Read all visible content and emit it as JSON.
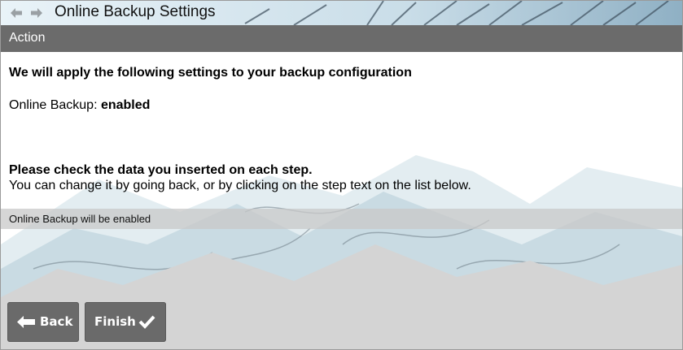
{
  "window": {
    "title": "Online Backup Settings",
    "nav_back_icon": "arrow-left-icon",
    "nav_forward_icon": "arrow-right-icon"
  },
  "action_bar": {
    "label": "Action"
  },
  "content": {
    "heading": "We will apply the following settings to your backup configuration",
    "online_backup_label": "Online Backup: ",
    "online_backup_value": "enabled",
    "check_heading": "Please check the data you inserted on each step.",
    "check_sub": "You can change it by going back, or by clicking on the step text on the list below.",
    "steps": [
      {
        "label": "Online Backup will be enabled"
      }
    ]
  },
  "buttons": {
    "back": {
      "label": "Back",
      "icon": "arrow-left-icon"
    },
    "finish": {
      "label": "Finish",
      "icon": "checkmark-icon"
    }
  },
  "colors": {
    "action_bar": "#6b6b6b",
    "button": "#6a6a6a",
    "text": "#000000",
    "step_row": "#c8c8c8"
  }
}
